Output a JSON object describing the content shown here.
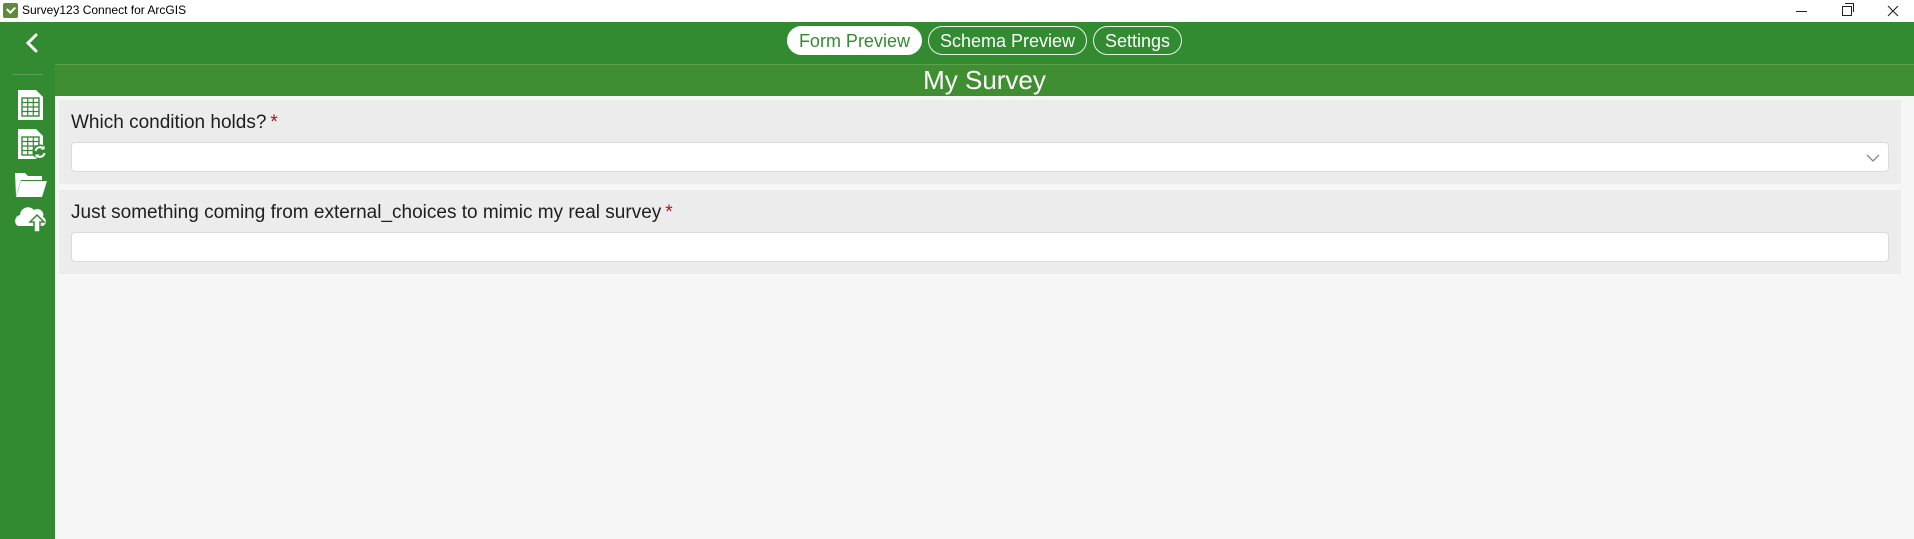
{
  "window": {
    "title": "Survey123 Connect for ArcGIS",
    "controls": [
      "minimize",
      "restore",
      "close"
    ]
  },
  "sidebar": {
    "back_icon": "chevron-left-icon",
    "items": [
      {
        "name": "new-survey",
        "icon": "spreadsheet-icon"
      },
      {
        "name": "new-survey-from-file",
        "icon": "spreadsheet-refresh-icon"
      },
      {
        "name": "open-folder",
        "icon": "folder-icon"
      },
      {
        "name": "publish",
        "icon": "cloud-upload-icon"
      }
    ]
  },
  "header": {
    "tabs": [
      {
        "label": "Form Preview",
        "active": true
      },
      {
        "label": "Schema Preview",
        "active": false
      },
      {
        "label": "Settings",
        "active": false
      }
    ],
    "survey_title": "My Survey"
  },
  "form": {
    "questions": [
      {
        "label": "Which condition holds?",
        "required_mark": "*",
        "type": "select",
        "value": ""
      },
      {
        "label": "Just something coming from external_choices to mimic my real survey",
        "required_mark": "*",
        "type": "text",
        "value": ""
      }
    ]
  },
  "colors": {
    "header_green": "#338b31",
    "title_band_green": "#3f8f32",
    "required_red": "#a8141a"
  }
}
